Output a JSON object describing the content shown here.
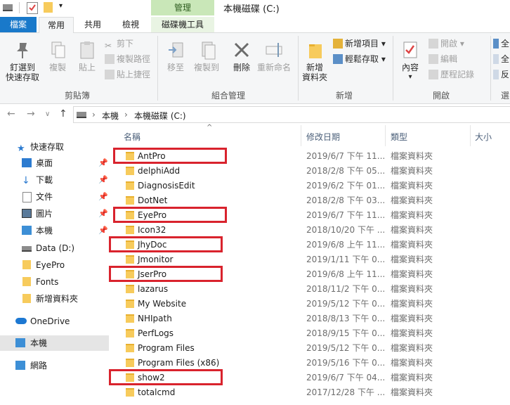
{
  "titlebar": {
    "contextual_tab": "管理",
    "window_title": "本機磁碟 (C:)"
  },
  "tabs": {
    "file": "檔案",
    "home": "常用",
    "share": "共用",
    "view": "檢視",
    "drive_tools": "磁碟機工具"
  },
  "ribbon": {
    "pin": "釘選到\n快速存取",
    "copy": "複製",
    "paste": "貼上",
    "cut": "剪下",
    "copy_path": "複製路徑",
    "paste_shortcut": "貼上捷徑",
    "clipboard_group": "剪貼簿",
    "move_to": "移至",
    "copy_to": "複製到",
    "delete": "刪除",
    "rename": "重新命名",
    "organize_group": "組合管理",
    "new_folder": "新增\n資料夾",
    "new_item": "新增項目",
    "easy_access": "輕鬆存取",
    "new_group": "新增",
    "properties": "內容",
    "open": "開啟",
    "edit": "編輯",
    "history": "歷程記錄",
    "open_group": "開啟",
    "select_all_partial": "全",
    "select_none_partial": "全",
    "invert_partial": "反",
    "select_group_partial": "選"
  },
  "address": {
    "crumbs": [
      "本機",
      "本機磁碟 (C:)"
    ]
  },
  "nav": {
    "quick_access": "快速存取",
    "desktop": "桌面",
    "downloads": "下載",
    "documents": "文件",
    "pictures": "圖片",
    "this_pc_pinned": "本機",
    "data_d": "Data (D:)",
    "eyepro": "EyePro",
    "fonts": "Fonts",
    "new_folder": "新增資料夾",
    "onedrive": "OneDrive",
    "this_pc": "本機",
    "network": "網路"
  },
  "columns": {
    "name": "名稱",
    "date": "修改日期",
    "type": "類型",
    "size": "大小"
  },
  "files": [
    {
      "name": "AntPro",
      "date": "2019/6/7 下午 11...",
      "type": "檔案資料夾",
      "highlighted": true
    },
    {
      "name": "delphiAdd",
      "date": "2018/2/8 下午 05...",
      "type": "檔案資料夾",
      "highlighted": false
    },
    {
      "name": "DiagnosisEdit",
      "date": "2019/6/2 下午 01...",
      "type": "檔案資料夾",
      "highlighted": false
    },
    {
      "name": "DotNet",
      "date": "2018/2/8 下午 03...",
      "type": "檔案資料夾",
      "highlighted": false
    },
    {
      "name": "EyePro",
      "date": "2019/6/7 下午 11...",
      "type": "檔案資料夾",
      "highlighted": true
    },
    {
      "name": "Icon32",
      "date": "2018/10/20 下午 ...",
      "type": "檔案資料夾",
      "highlighted": false
    },
    {
      "name": "JhyDoc",
      "date": "2019/6/8 上午 11...",
      "type": "檔案資料夾",
      "highlighted": true
    },
    {
      "name": "Jmonitor",
      "date": "2019/1/11 下午 0...",
      "type": "檔案資料夾",
      "highlighted": false
    },
    {
      "name": "JserPro",
      "date": "2019/6/8 上午 11...",
      "type": "檔案資料夾",
      "highlighted": true
    },
    {
      "name": "lazarus",
      "date": "2018/11/2 下午 0...",
      "type": "檔案資料夾",
      "highlighted": false
    },
    {
      "name": "My Website",
      "date": "2019/5/12 下午 0...",
      "type": "檔案資料夾",
      "highlighted": false
    },
    {
      "name": "NHIpath",
      "date": "2018/8/13 下午 0...",
      "type": "檔案資料夾",
      "highlighted": false
    },
    {
      "name": "PerfLogs",
      "date": "2018/9/15 下午 0...",
      "type": "檔案資料夾",
      "highlighted": false
    },
    {
      "name": "Program Files",
      "date": "2019/5/12 下午 0...",
      "type": "檔案資料夾",
      "highlighted": false
    },
    {
      "name": "Program Files (x86)",
      "date": "2019/5/16 下午 0...",
      "type": "檔案資料夾",
      "highlighted": false
    },
    {
      "name": "show2",
      "date": "2019/6/7 下午 04...",
      "type": "檔案資料夾",
      "highlighted": true
    },
    {
      "name": "totalcmd",
      "date": "2017/12/28 下午 ...",
      "type": "檔案資料夾",
      "highlighted": false
    }
  ],
  "colors": {
    "file_tab": "#1979ca",
    "highlight": "#d9232d",
    "folder": "#f7cb5c"
  }
}
